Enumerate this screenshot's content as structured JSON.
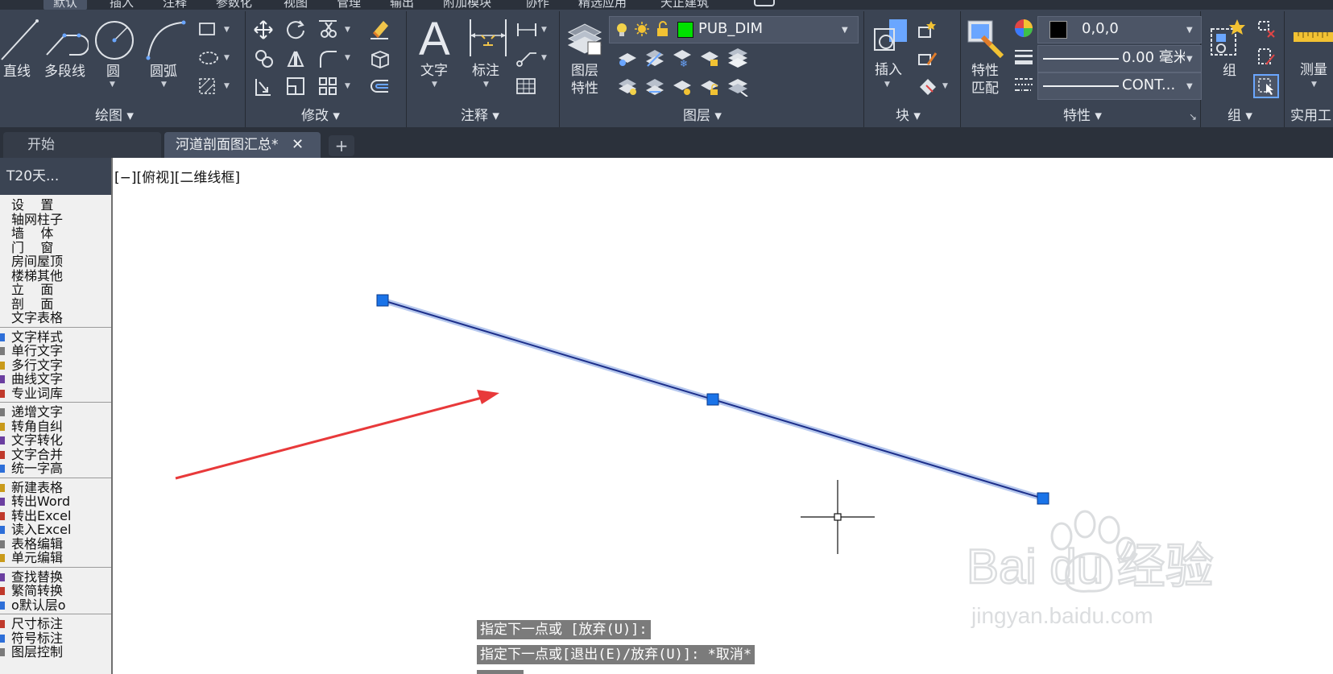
{
  "ribbon": {
    "tabs": [
      "默认",
      "插入",
      "注释",
      "参数化",
      "视图",
      "管理",
      "输出",
      "附加模块",
      "协作",
      "精选应用",
      "天正建筑"
    ],
    "draw": {
      "line": "直线",
      "polyline": "多段线",
      "circle": "圆",
      "arc": "圆弧",
      "panel_label": "绘图 ▾"
    },
    "modify": {
      "panel_label": "修改 ▾"
    },
    "annotation": {
      "text_glyph": "A",
      "text": "文字",
      "dimension": "标注",
      "panel_label": "注释 ▾"
    },
    "layers": {
      "layer_props_line1": "图层",
      "layer_props_line2": "特性",
      "current_layer": "PUB_DIM",
      "current_layer_color": "#00e000",
      "panel_label": "图层 ▾"
    },
    "block": {
      "insert": "插入",
      "panel_label": "块 ▾"
    },
    "properties": {
      "match_line1": "特性",
      "match_line2": "匹配",
      "color_value": "0,0,0",
      "lineweight_value": "0.00 毫米",
      "linetype_value": "CONT...",
      "panel_label": "特性 ▾"
    },
    "groups": {
      "group": "组",
      "panel_label": "组 ▾"
    },
    "utilities": {
      "measure": "测量",
      "panel_label": "实用工"
    }
  },
  "doc_tabs": {
    "start": "开始",
    "active": "河道剖面图汇总*",
    "close_glyph": "✕",
    "new_tab_glyph": "+"
  },
  "palette": {
    "title": "T20天...",
    "groups": [
      [
        "设    置",
        "轴网柱子",
        "墙    体",
        "门    窗",
        "房间屋顶",
        "楼梯其他",
        "立    面",
        "剖    面",
        "文字表格"
      ],
      [
        "文字样式",
        "单行文字",
        "多行文字",
        "曲线文字",
        "专业词库"
      ],
      [
        "递增文字",
        "转角自纠",
        "文字转化",
        "文字合并",
        "统一字高"
      ],
      [
        "新建表格",
        "转出Word",
        "转出Excel",
        "读入Excel",
        "表格编辑",
        "单元编辑"
      ],
      [
        "查找替换",
        "繁简转换",
        "o默认层o"
      ],
      [
        "尺寸标注",
        "符号标注",
        "图层控制"
      ]
    ]
  },
  "canvas": {
    "viewport_label": "[−][俯视][二维线框]",
    "command_lines": [
      "指定下一点或 [放弃(U)]:",
      "指定下一点或[退出(E)/放弃(U)]: *取消*"
    ],
    "line_color": "#1d2f8a",
    "grip_color": "#1a73e8",
    "arrow_color": "#e8393a"
  },
  "watermark": {
    "brand": "Bai du 经验",
    "url": "jingyan.baidu.com"
  }
}
